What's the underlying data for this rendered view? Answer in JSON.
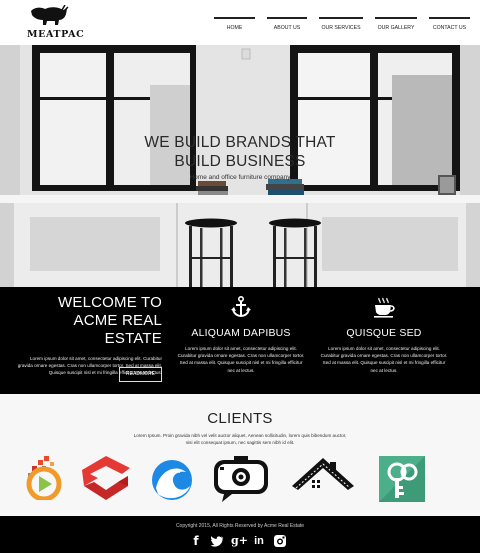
{
  "brand": {
    "name": "Meatpac"
  },
  "nav": {
    "items": [
      "HOME",
      "ABOUT US",
      "OUR SERVICES",
      "OUR GALLERY",
      "CONTACT US"
    ]
  },
  "hero": {
    "title_line1": "WE BUILD BRANDS THAT",
    "title_line2": "BUILD BUSINESS",
    "subtitle": "Home and office furniture company"
  },
  "welcome": {
    "title_line1": "WELCOME TO",
    "title_line2": "ACME REAL ESTATE",
    "body": "Lorem ipsum dolor sit amet, consectetur adipiscing elit. Curabitur gravida ornare egestas. Cras non ullamcorper tortor. Sed at massa elit. Quisque suscipit nisl et mi fringilla efficitur nec at lectus.",
    "button": "READMORE"
  },
  "features": [
    {
      "icon": "anchor-icon",
      "title": "ALIQUAM DAPIBUS",
      "body": "Lorem ipsum dolor sit amet, consectetur adipiscing elit. Curabitur gravida ornare egestas. Cras non ullamcorper tortor. Sed at massa elit. Quisque suscipit nisl et mi fringilla efficitur nec at lectus."
    },
    {
      "icon": "coffee-cup-icon",
      "title": "QUISQUE SED",
      "body": "Lorem ipsum dolor sit amet, consectetur adipiscing elit. Curabitur gravida ornare egestas. Cras non ullamcorper tortor. Sed at massa elit. Quisque suscipit nisl et mi fringilla efficitur nec at lectus."
    }
  ],
  "clients": {
    "title": "CLIENTS",
    "body": "Lorem Ipsum. Proin gravida nibh vel velit auctor aliquet. Aenean sollicitudin, lorem quis bibendum auctor, nisi elit consequat ipsum, nec sagittis sem nibh id elit.",
    "logos": [
      "play-pixel-logo",
      "red-ribbon-logo",
      "blue-wave-logo",
      "camera-chat-logo",
      "house-roof-logo",
      "green-tool-logo"
    ]
  },
  "footer": {
    "copyright": "Copyright 2015, All Rights Reserved by Acme Real Estate",
    "social": [
      {
        "icon": "facebook-icon",
        "glyph": "f"
      },
      {
        "icon": "twitter-icon",
        "glyph": "t"
      },
      {
        "icon": "google-plus-icon",
        "glyph": "g+"
      },
      {
        "icon": "linkedin-icon",
        "glyph": "in"
      },
      {
        "icon": "instagram-icon",
        "glyph": "◘"
      }
    ]
  },
  "colors": {
    "band": "#000000",
    "clients_bg": "#f7f7f7",
    "text": "#111111"
  }
}
